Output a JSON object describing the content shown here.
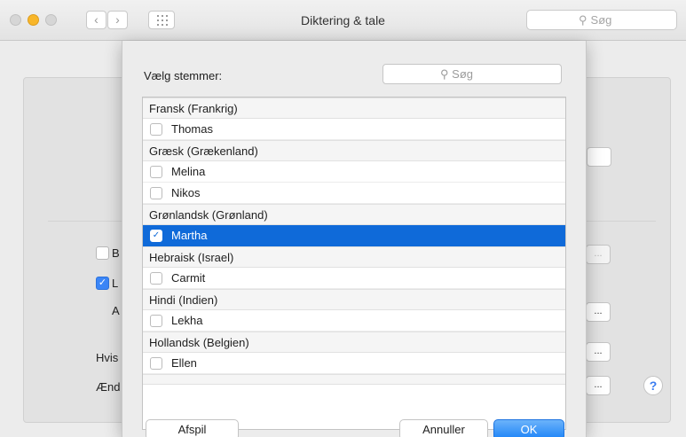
{
  "window": {
    "title": "Diktering & tale",
    "search_placeholder": "Søg"
  },
  "background": {
    "labels": {
      "b": "B",
      "l": "L",
      "a": "A",
      "hvis": "Hvis",
      "aend": "Ænd"
    },
    "button_ellipsis": "...",
    "help": "?"
  },
  "sheet": {
    "title": "Vælg stemmer:",
    "search_placeholder": "Søg",
    "rows": [
      {
        "type": "header",
        "label": "Fransk (Frankrig)"
      },
      {
        "type": "item",
        "label": "Thomas",
        "checked": false
      },
      {
        "type": "header",
        "label": "Græsk (Grækenland)"
      },
      {
        "type": "item",
        "label": "Melina",
        "checked": false
      },
      {
        "type": "item",
        "label": "Nikos",
        "checked": false
      },
      {
        "type": "header",
        "label": "Grønlandsk (Grønland)"
      },
      {
        "type": "item",
        "label": "Martha",
        "checked": true,
        "selected": true
      },
      {
        "type": "header",
        "label": "Hebraisk (Israel)"
      },
      {
        "type": "item",
        "label": "Carmit",
        "checked": false
      },
      {
        "type": "header",
        "label": "Hindi (Indien)"
      },
      {
        "type": "item",
        "label": "Lekha",
        "checked": false
      },
      {
        "type": "header",
        "label": "Hollandsk (Belgien)"
      },
      {
        "type": "item",
        "label": "Ellen",
        "checked": false
      }
    ],
    "buttons": {
      "play": "Afspil",
      "cancel": "Annuller",
      "ok": "OK"
    }
  },
  "colors": {
    "selection": "#0f6ad9",
    "accent": "#1a82f7"
  }
}
